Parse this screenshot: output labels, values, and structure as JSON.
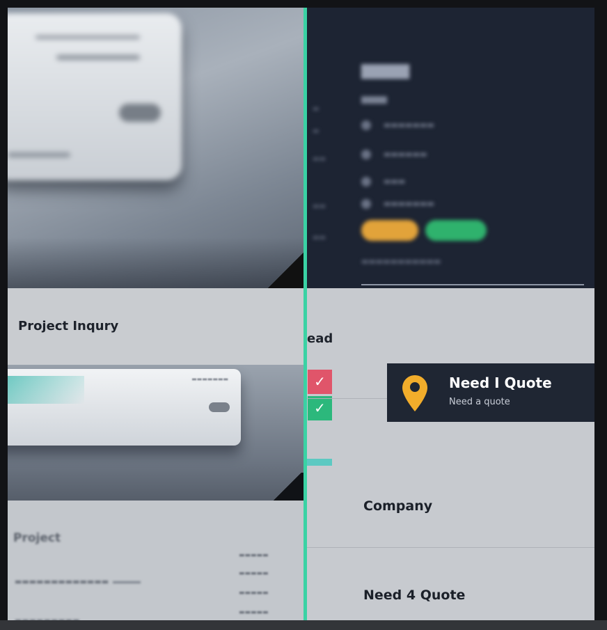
{
  "left": {
    "inquiry_title": "Project Inqury",
    "project_title": "Project"
  },
  "right": {
    "lead_fragment": "ead",
    "company_label": "Company",
    "quote_label": "Need 4 Quote"
  },
  "quote_card": {
    "title": "Need I Quote",
    "subtitle": "Need a quote",
    "icon": "map-pin-icon",
    "icon_color": "#f2ad2b"
  },
  "checks": [
    {
      "icon": "check-icon",
      "color": "#e0556a"
    },
    {
      "icon": "check-icon",
      "color": "#2cb87c"
    }
  ],
  "colors": {
    "divider": "#3ad2a4",
    "dark_panel": "#1d2433",
    "card_bg": "#1f2633"
  }
}
